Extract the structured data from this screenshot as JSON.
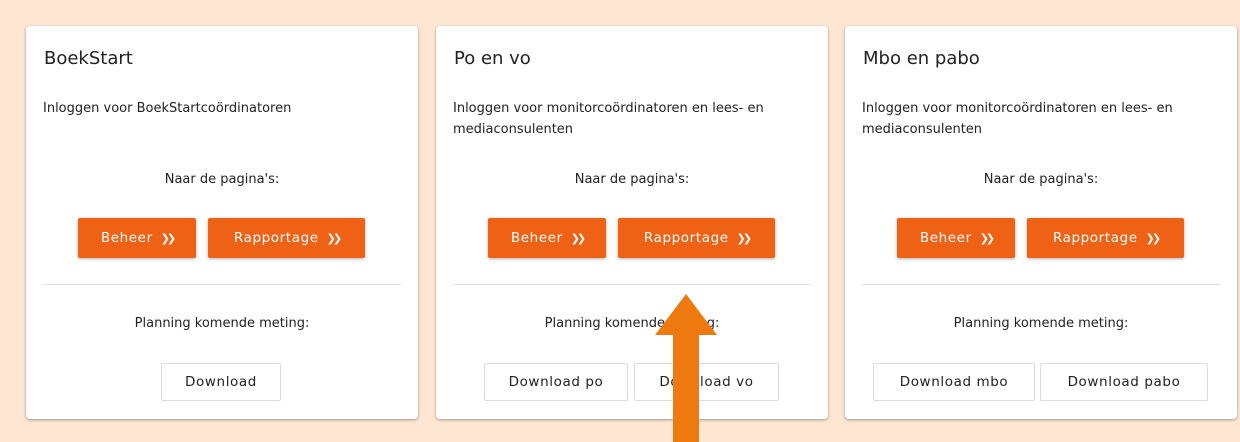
{
  "cards": [
    {
      "title": "BoekStart",
      "description": "Inloggen voor BoekStartcoördinatoren",
      "pages_label": "Naar de pagina's:",
      "beheer_label": "Beheer",
      "rapportage_label": "Rapportage",
      "planning_label": "Planning komende meting:",
      "downloads": [
        "Download"
      ]
    },
    {
      "title": "Po en vo",
      "description": "Inloggen voor monitorcoördinatoren en lees- en mediaconsulenten",
      "pages_label": "Naar de pagina's:",
      "beheer_label": "Beheer",
      "rapportage_label": "Rapportage",
      "planning_label": "Planning komende meting:",
      "downloads": [
        "Download po",
        "Download vo"
      ]
    },
    {
      "title": "Mbo en pabo",
      "description": "Inloggen voor monitorcoördinatoren en lees- en mediaconsulenten",
      "pages_label": "Naar de pagina's:",
      "beheer_label": "Beheer",
      "rapportage_label": "Rapportage",
      "planning_label": "Planning komende meting:",
      "downloads": [
        "Download mbo",
        "Download pabo"
      ]
    }
  ],
  "arrow_icon": "double-chevron-right-icon",
  "colors": {
    "accent": "#ef6216",
    "background": "#fde7d3",
    "annotation_arrow": "#ee7a0f"
  }
}
